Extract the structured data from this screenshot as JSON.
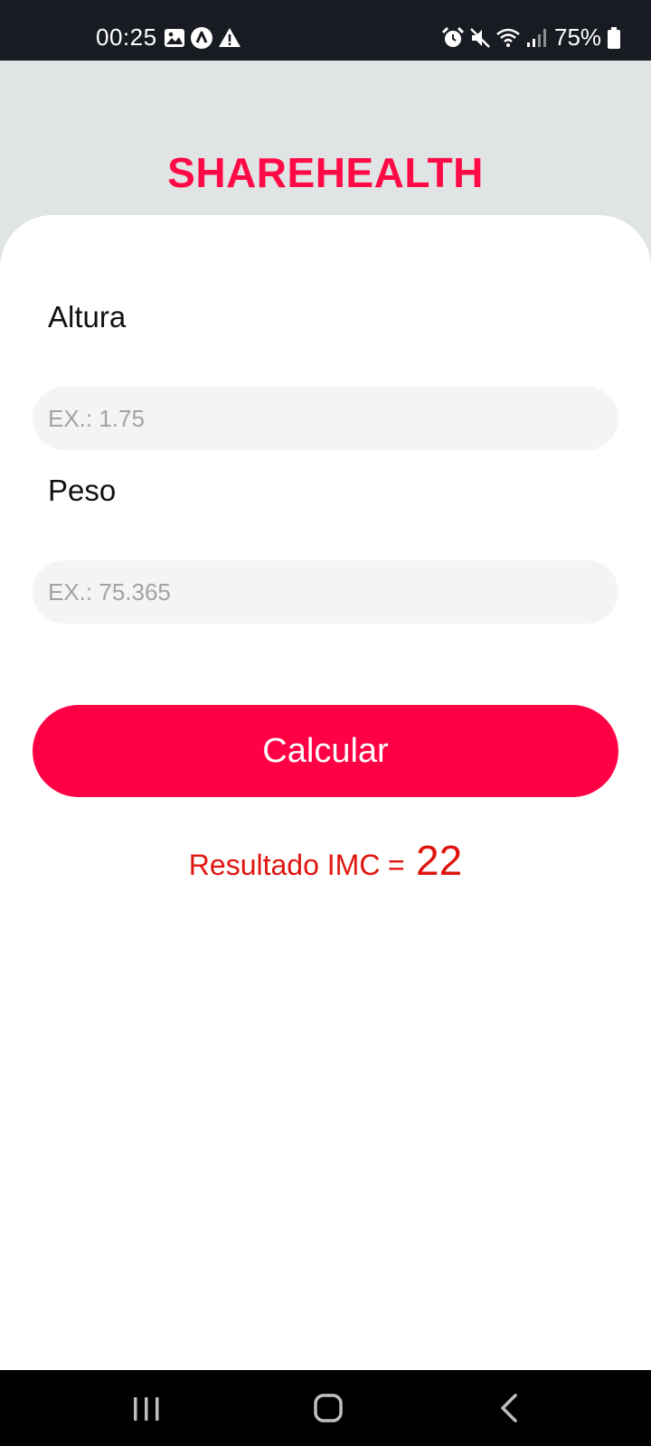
{
  "status_bar": {
    "time": "00:25",
    "battery": "75%",
    "left_icons": [
      "gallery-icon",
      "app-notification-icon",
      "warning-icon"
    ],
    "right_icons": [
      "alarm-icon",
      "mute-icon",
      "wifi-icon",
      "signal-icon",
      "battery-icon"
    ]
  },
  "app": {
    "title": "SHAREHEALTH",
    "accent_color": "#ff0a47"
  },
  "form": {
    "height": {
      "label": "Altura",
      "placeholder": "EX.: 1.75",
      "value": ""
    },
    "weight": {
      "label": "Peso",
      "placeholder": "EX.: 75.365",
      "value": ""
    },
    "calculate_label": "Calcular"
  },
  "result": {
    "label": "Resultado IMC",
    "equals": "=",
    "value": "22",
    "color": "#e0140f"
  },
  "nav_bar": {
    "buttons": [
      "recent-apps-icon",
      "home-icon",
      "back-icon"
    ]
  }
}
